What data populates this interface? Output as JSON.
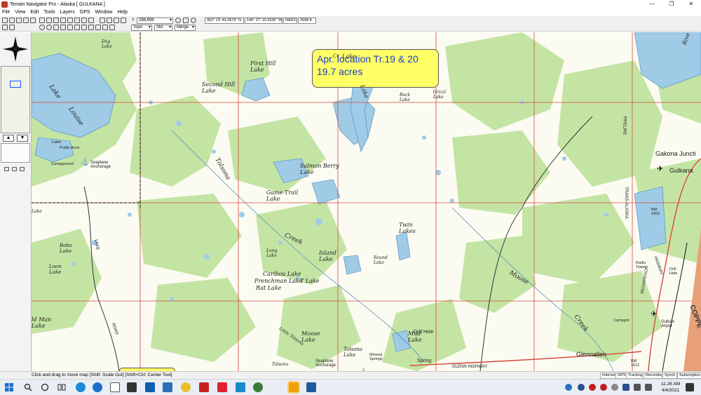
{
  "window": {
    "title": "Terrain Navigator Pro - Alaska [ GULKANA ]",
    "controls": [
      "—",
      "❐",
      "✕"
    ]
  },
  "menu": [
    "File",
    "View",
    "Edit",
    "Tools",
    "Layers",
    "GPS",
    "Window",
    "Help"
  ],
  "toolbar": {
    "scale_prefix": "1:",
    "scale": "288,696",
    "coord_lat": "062° 23' 43.2676\" N",
    "coord_lon": "146° 27' 10.3336\" W",
    "datum": "NAD27",
    "elevation": "2598 ft",
    "map_type": "Topo",
    "style": "Std",
    "blend": "Merge"
  },
  "callout": {
    "line1": "Apr. location  Tr.19 & 20",
    "line2": "19.7 acres"
  },
  "map_labels": {
    "first_hill_lake": "First Hill\nLake",
    "second_hill_lake": "Second Hill\nLake",
    "lake_louise_1": "Lake",
    "lake_louise_2": "Louise",
    "salmon_berry_lake": "Salmon Berry\nLake",
    "game_trail_lake": "Game Trail\nLake",
    "tolsona_creek": "Tolsona",
    "creek": "Creek",
    "twin_lakes": "Twin\nLakes",
    "island_lake": "Island\nLake",
    "round_lake": "Round\nLake",
    "caribou_lake": "Caribou Lake",
    "frenchman_lake": "Frenchman Lake",
    "rat_lake": "Rat Lake",
    "t_lake": "T Lake",
    "long_lake": "Long\nLake",
    "bobs_lake": "Bobs\nLake",
    "loon_lake": "Loon\nLake",
    "old_man_lake": "ld Man\nLake",
    "moose_lake": "Moose\nLake",
    "mud_lake": "Mud\nLake",
    "drill_hole": "Drill Hole",
    "spring": "Spring",
    "tolsona_lake": "Tolsona\nLake",
    "moose_creek": "Moose",
    "creek2": "Creek",
    "glennallen": "Glennallen",
    "gakona_junction": "Gakona Juncti",
    "gulkana": "Gulkana",
    "pipeline": "PIPELINE",
    "trans_alaska": "TRANS-ALASKA",
    "highway": "HIGHWAY",
    "copper": "COPPE",
    "rock_lake": "Rock\nLake",
    "grizz_lake": "Grizzl\nLake",
    "road": "ROAD",
    "lake_road": "LAKE",
    "seaplane": "Seaplane\nAnchorage",
    "seaplane2": "Seaplane\nAnchorage",
    "public_access": "Public Acce",
    "campground": "Campground",
    "cabin": "Cabin",
    "gulkana_airport": "Gulkan\nAirpor",
    "richardson": "RICHARDSON",
    "radio_tower": "Radio\nTower",
    "campgrd2": "Campgrd",
    "drill_hole2": "Drill\nHole",
    "lake_upper": "Lake",
    "crater_lake": "Cr",
    "upper_lake": "Lake",
    "lake_dist": "Lake",
    "dog_lake": "Dog\nLake",
    "bm_1603": "BM\n1603",
    "bm_1512": "BM\n1512",
    "tolsona_creek_bottom": "Tolsona",
    "mineral_springs": "Mineral\nSprings",
    "little_tolsona": "Little Tolsona",
    "glenn_highway": "GLENN      HIGHWAY",
    "river": "Rive"
  },
  "status": {
    "message": "Click and drag to move map [Shift: Scale Out] [Shift+Ctrl: Center Tool]",
    "indicators": [
      "Internet",
      "GPS",
      "Tracking",
      "Recording",
      "Synch",
      "Subscription"
    ]
  },
  "taskbar": {
    "time": "11:26 AM",
    "date": "4/4/2021"
  }
}
